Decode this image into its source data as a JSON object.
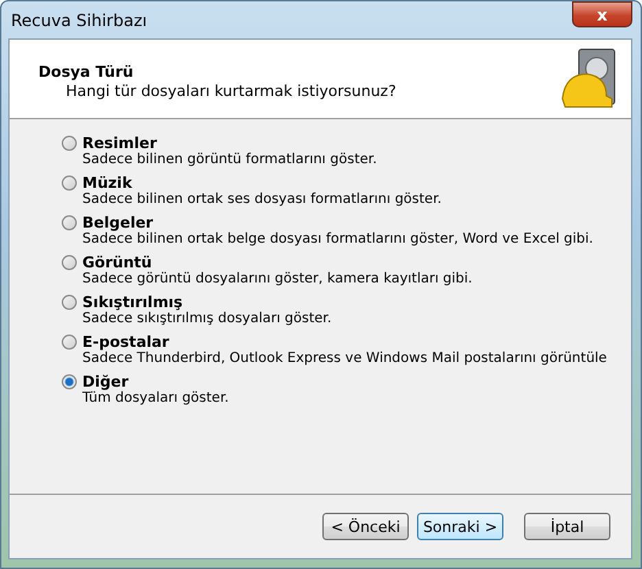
{
  "window": {
    "title": "Recuva Sihirbazı",
    "close": "x"
  },
  "header": {
    "title": "Dosya Türü",
    "subtitle": "Hangi tür dosyaları kurtarmak istiyorsunuz?"
  },
  "options": [
    {
      "label": "Resimler",
      "description": "Sadece bilinen görüntü formatlarını göster.",
      "selected": false
    },
    {
      "label": "Müzik",
      "description": "Sadece bilinen ortak ses dosyası formatlarını göster.",
      "selected": false
    },
    {
      "label": "Belgeler",
      "description": "Sadece bilinen ortak belge dosyası formatlarını göster, Word ve Excel gibi.",
      "selected": false
    },
    {
      "label": "Görüntü",
      "description": "Sadece görüntü dosyalarını göster, kamera kayıtları gibi.",
      "selected": false
    },
    {
      "label": "Sıkıştırılmış",
      "description": "Sadece sıkıştırılmış dosyaları göster.",
      "selected": false
    },
    {
      "label": "E-postalar",
      "description": "Sadece Thunderbird, Outlook Express ve Windows Mail postalarını görüntüle",
      "selected": false
    },
    {
      "label": "Diğer",
      "description": "Tüm dosyaları göster.",
      "selected": true
    }
  ],
  "buttons": [
    {
      "label": "< Önceki",
      "focused": false
    },
    {
      "label": "Sonraki >",
      "focused": true
    },
    {
      "label": "İptal",
      "focused": false
    }
  ]
}
